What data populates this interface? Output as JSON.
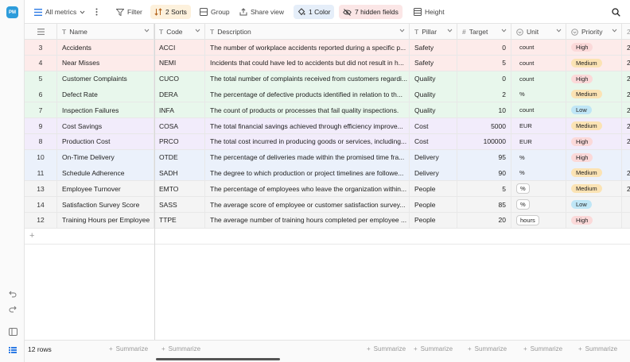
{
  "app": {
    "avatar_initials": "PM"
  },
  "toolbar": {
    "view_name": "All metrics",
    "filter_label": "Filter",
    "sorts_label": "2 Sorts",
    "group_label": "Group",
    "share_label": "Share view",
    "color_label": "1 Color",
    "hidden_label": "7 hidden fields",
    "height_label": "Height"
  },
  "columns": {
    "name": "Name",
    "code": "Code",
    "description": "Description",
    "pillar": "Pillar",
    "target": "Target",
    "unit": "Unit",
    "priority": "Priority",
    "overflow": "2"
  },
  "colors": {
    "Safety": "#fdebea",
    "Quality": "#e8f7ec",
    "Cost": "#f2ecfb",
    "Delivery": "#ebf1fb",
    "People": "#f4f4f4",
    "High": "#fbd9d9",
    "Medium": "#fbe3b4",
    "Low": "#bfe6f6"
  },
  "rows": [
    {
      "n": "3",
      "name": "Accidents",
      "code": "ACCI",
      "desc": "The number of workplace accidents reported during a specific p...",
      "pillar": "Safety",
      "target": "0",
      "unit": "count",
      "unit_box": false,
      "priority": "High",
      "extra": "2"
    },
    {
      "n": "4",
      "name": "Near Misses",
      "code": "NEMI",
      "desc": "Incidents that could have led to accidents but did not result in h...",
      "pillar": "Safety",
      "target": "5",
      "unit": "count",
      "unit_box": false,
      "priority": "Medium",
      "extra": "2"
    },
    {
      "n": "5",
      "name": "Customer Complaints",
      "code": "CUCO",
      "desc": "The total number of complaints received from customers regardi...",
      "pillar": "Quality",
      "target": "0",
      "unit": "count",
      "unit_box": false,
      "priority": "High",
      "extra": "2"
    },
    {
      "n": "6",
      "name": "Defect Rate",
      "code": "DERA",
      "desc": "The percentage of defective products identified in relation to th...",
      "pillar": "Quality",
      "target": "2",
      "unit": "%",
      "unit_box": false,
      "priority": "Medium",
      "extra": "2"
    },
    {
      "n": "7",
      "name": "Inspection Failures",
      "code": "INFA",
      "desc": "The count of products or processes that fail quality inspections.",
      "pillar": "Quality",
      "target": "10",
      "unit": "count",
      "unit_box": false,
      "priority": "Low",
      "extra": "2"
    },
    {
      "n": "9",
      "name": "Cost Savings",
      "code": "COSA",
      "desc": "The total financial savings achieved through efficiency improve...",
      "pillar": "Cost",
      "target": "5000",
      "unit": "EUR",
      "unit_box": false,
      "priority": "Medium",
      "extra": "2"
    },
    {
      "n": "8",
      "name": "Production Cost",
      "code": "PRCO",
      "desc": "The total cost incurred in producing goods or services, including...",
      "pillar": "Cost",
      "target": "100000",
      "unit": "EUR",
      "unit_box": false,
      "priority": "High",
      "extra": "2"
    },
    {
      "n": "10",
      "name": "On-Time Delivery",
      "code": "OTDE",
      "desc": "The percentage of deliveries made within the promised time fra...",
      "pillar": "Delivery",
      "target": "95",
      "unit": "%",
      "unit_box": false,
      "priority": "High",
      "extra": ""
    },
    {
      "n": "11",
      "name": "Schedule Adherence",
      "code": "SADH",
      "desc": "The degree to which production or project timelines are followe...",
      "pillar": "Delivery",
      "target": "90",
      "unit": "%",
      "unit_box": false,
      "priority": "Medium",
      "extra": "2"
    },
    {
      "n": "13",
      "name": "Employee Turnover",
      "code": "EMTO",
      "desc": "The percentage of employees who leave the organization within...",
      "pillar": "People",
      "target": "5",
      "unit": "%",
      "unit_box": true,
      "priority": "Medium",
      "extra": "2"
    },
    {
      "n": "14",
      "name": "Satisfaction Survey Score",
      "code": "SASS",
      "desc": "The average score of employee or customer satisfaction survey...",
      "pillar": "People",
      "target": "85",
      "unit": "%",
      "unit_box": true,
      "priority": "Low",
      "extra": ""
    },
    {
      "n": "12",
      "name": "Training Hours per Employee",
      "code": "TTPE",
      "desc": "The average number of training hours completed per employee ...",
      "pillar": "People",
      "target": "20",
      "unit": "hours",
      "unit_box": true,
      "priority": "High",
      "extra": ""
    }
  ],
  "footer": {
    "row_count": "12 rows",
    "summarize": "Summarize"
  },
  "add_row_symbol": "+"
}
